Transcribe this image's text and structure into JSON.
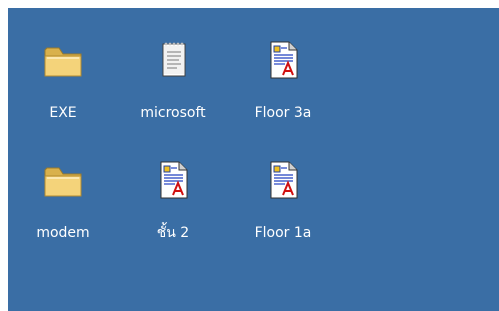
{
  "desktop": {
    "background": "#3a6ea5",
    "icons": [
      {
        "label": "EXE",
        "type": "folder-icon"
      },
      {
        "label": "microsoft",
        "type": "text-document-icon"
      },
      {
        "label": "Floor 3a",
        "type": "acrobat-document-icon"
      },
      {
        "label": "modem",
        "type": "folder-icon"
      },
      {
        "label": "ชั้น 2",
        "type": "acrobat-document-icon"
      },
      {
        "label": "Floor 1a",
        "type": "acrobat-document-icon"
      }
    ]
  }
}
